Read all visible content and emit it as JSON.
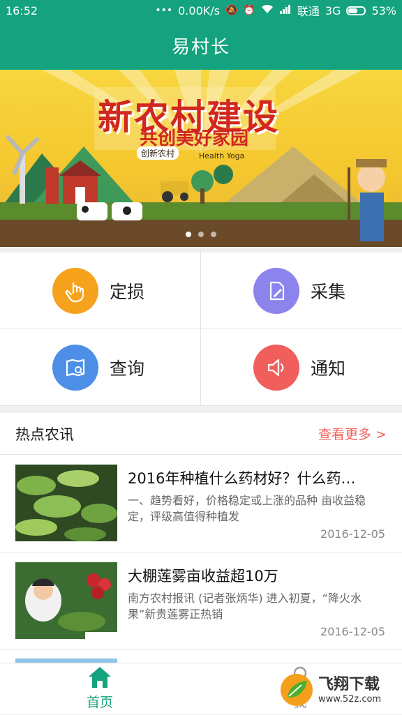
{
  "status": {
    "time": "16:52",
    "speed": "0.00K/s",
    "carrier": "联通",
    "network": "3G",
    "battery": "53%"
  },
  "appbar": {
    "title": "易村长"
  },
  "banner": {
    "headline": "新农村建设",
    "subheadline": "共创美好家园",
    "badge": "创新农村",
    "small": "Health Yoga",
    "page_index": 1,
    "page_count": 3
  },
  "actions": [
    {
      "label": "定损",
      "color": "#f7a21c",
      "icon": "touch-icon"
    },
    {
      "label": "采集",
      "color": "#8c83ec",
      "icon": "edit-document-icon"
    },
    {
      "label": "查询",
      "color": "#4d8fe6",
      "icon": "book-search-icon"
    },
    {
      "label": "通知",
      "color": "#f05f5c",
      "icon": "speaker-icon"
    }
  ],
  "news": {
    "section_title": "热点农讯",
    "more_label": "查看更多 >",
    "items": [
      {
        "title": "2016年种植什么药材好？什么药…",
        "summary": "一、趋势看好，价格稳定或上涨的品种  亩收益稳定，评级高值得种植发",
        "date": "2016-12-05"
      },
      {
        "title": "大棚莲雾亩收益超10万",
        "summary": "南方农村报讯 (记者张炳华)    进入初夏，“降火水果”新贵莲雾正热销",
        "date": "2016-12-05"
      }
    ]
  },
  "tabbar": {
    "home_label": "首页",
    "me_label": "我"
  },
  "watermark": {
    "brand": "飞翔下载",
    "url": "www.52z.com"
  },
  "colors": {
    "primary": "#14a37e",
    "accent_red": "#f2645e"
  }
}
